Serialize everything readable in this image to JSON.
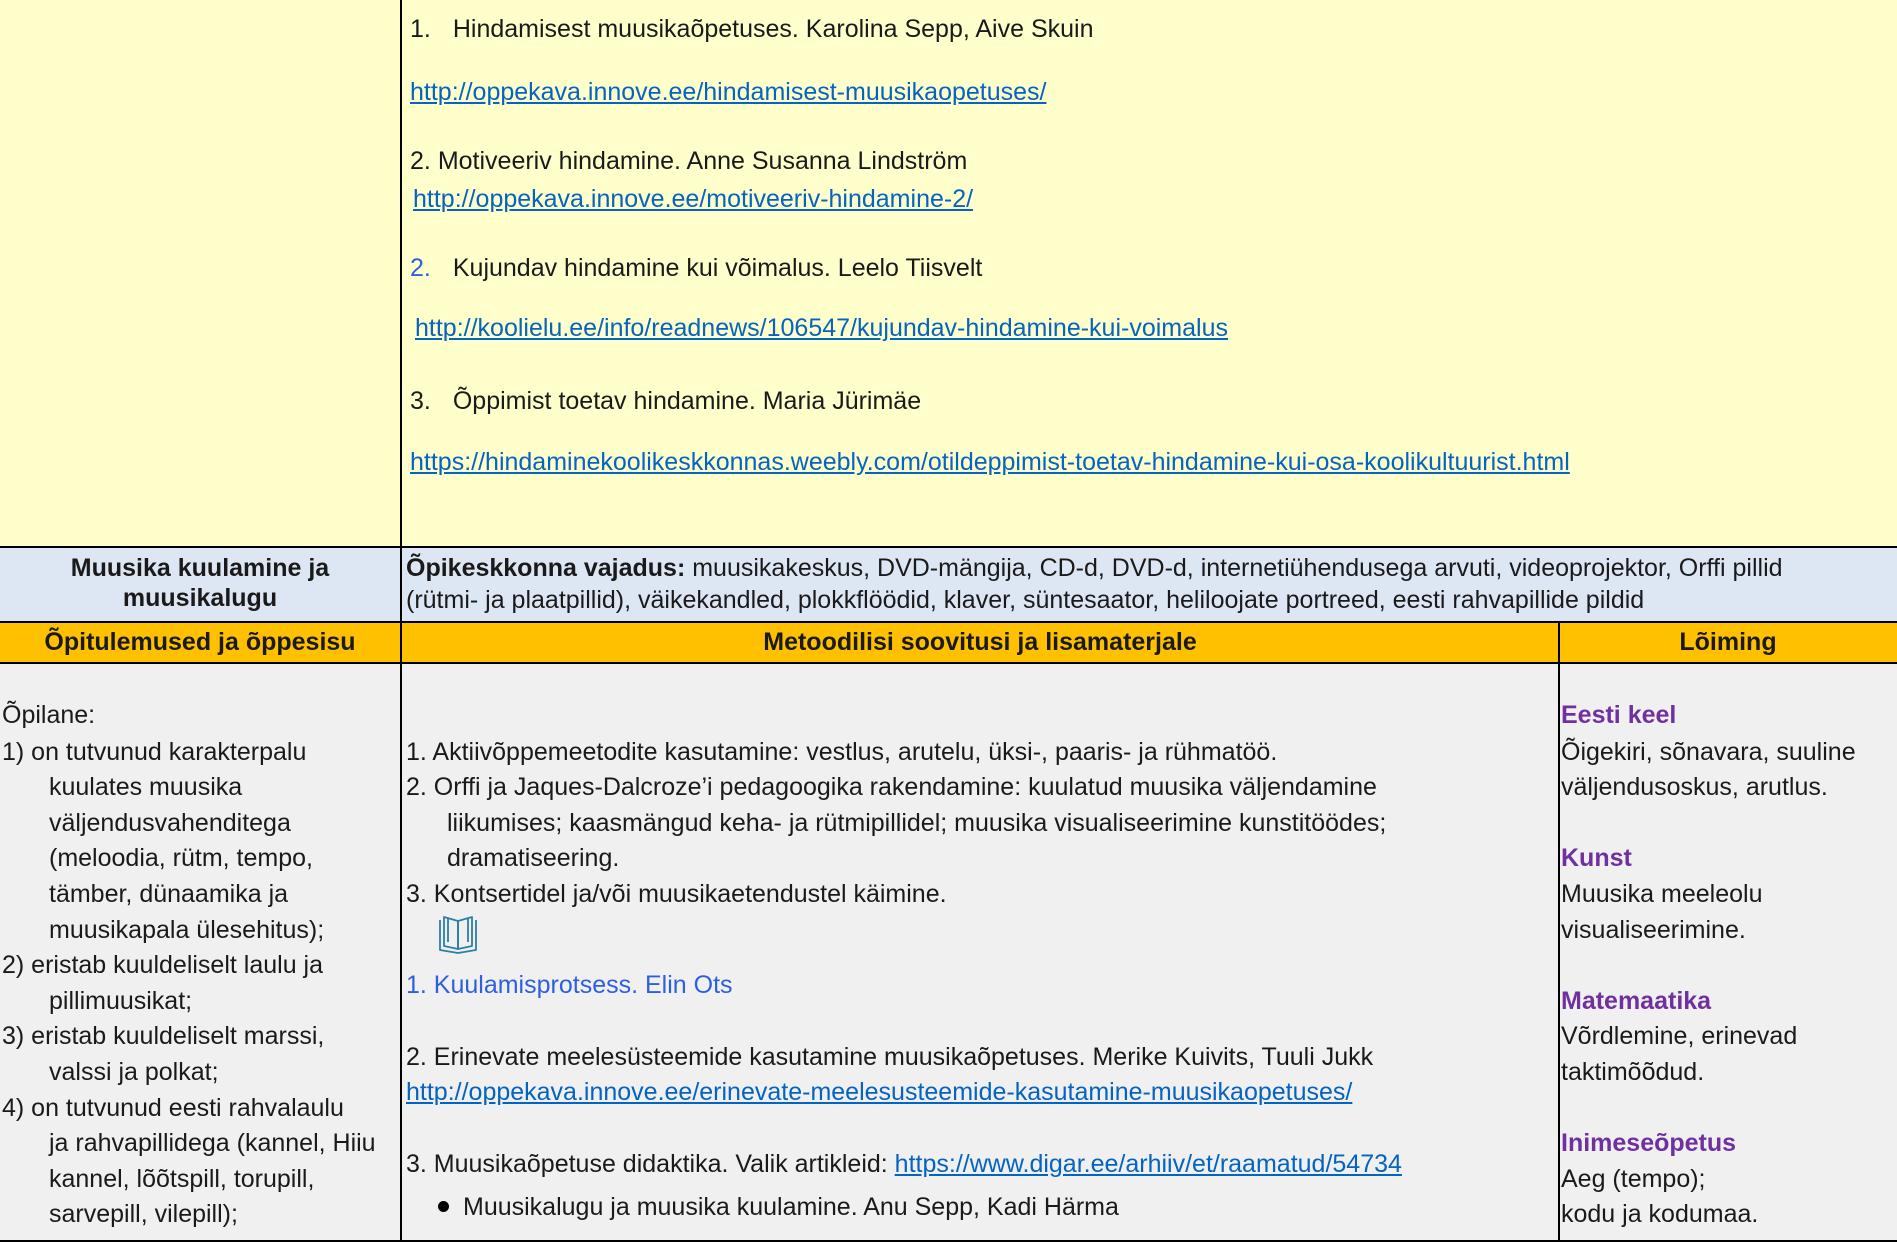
{
  "resources": [
    {
      "num": "1.",
      "text": "Hindamisest muusikaõpetuses. Karolina Sepp, Aive Skuin",
      "url": "http://oppekava.innove.ee/hindamisest-muusikaopetuses/"
    },
    {
      "num": "2.",
      "text": "Motiveeriv hindamine. Anne Susanna Lindström",
      "url": "http://oppekava.innove.ee/motiveeriv-hindamine-2/"
    },
    {
      "num": "2.",
      "text": "Kujundav hindamine kui võimalus. Leelo Tiisvelt",
      "url": "http://koolielu.ee/info/readnews/106547/kujundav-hindamine-kui-voimalus"
    },
    {
      "num": "3.",
      "text": "Õppimist toetav hindamine. Maria Jürimäe",
      "url": "https://hindaminekoolikeskkonnas.weebly.com/otildeppimist-toetav-hindamine-kui-osa-koolikultuurist.html"
    }
  ],
  "section": {
    "title_line1": "Muusika kuulamine ja",
    "title_line2": "muusikalugu",
    "env_label": "Õpikeskkonna  vajadus:",
    "env_text_line1": " muusikakeskus, DVD-mängija, CD-d, DVD-d, internetiühendusega arvuti, videoprojektor, Orffi pillid",
    "env_text_line2": "(rütmi- ja plaatpillid), väikekandled, plokkflöödid, klaver, süntesaator, heliloojate portreed, eesti rahvapillide pildid"
  },
  "headers": {
    "col1": "Õpitulemused ja õppesisu",
    "col2": "Metoodilisi soovitusi ja lisamaterjale",
    "col3": "Lõiming"
  },
  "outcomes": {
    "intro": "Õpilane:",
    "lines": [
      "1) on tutvunud karakterpalu",
      "kuulates muusika",
      "väljendusvahenditega",
      "(meloodia, rütm, tempo,",
      "tämber, dünaamika ja",
      "muusikapala ülesehitus);",
      "2) eristab kuuldeliselt laulu ja",
      "pillimuusikat;",
      "3) eristab kuuldeliselt marssi,",
      "valssi ja polkat;",
      "4) on tutvunud eesti rahvalaulu",
      "ja rahvapillidega (kannel, Hiiu",
      "kannel, lõõtspill, torupill,",
      "sarvepill, vilepill);"
    ]
  },
  "methods": {
    "lines": [
      "1. Aktiivõppemeetodite kasutamine: vestlus, arutelu, üksi-, paaris- ja rühmatöö.",
      "2. Orffi ja Jaques-Dalcroze’i pedagoogika rakendamine: kuulatud muusika väljendamine",
      "liikumises; kaasmängud keha- ja rütmipillidel; muusika visualiseerimine kunstitöödes;",
      "dramatiseering.",
      "3. Kontsertidel ja/või muusikaetendustel käimine."
    ],
    "book_icon": "open-book-icon",
    "ref1": "1. Kuulamisprotsess. Elin Ots",
    "ref2": "2. Erinevate meelesüsteemide kasutamine muusikaõpetuses. Merike Kuivits, Tuuli Jukk",
    "ref2_url": "http://oppekava.innove.ee/erinevate-meelesusteemide-kasutamine-muusikaopetuses/",
    "ref3_text": "3. Muusikaõpetuse didaktika. Valik artikleid: ",
    "ref3_url": "https://www.digar.ee/arhiiv/et/raamatud/54734",
    "bullet1": "Muusikalugu ja muusika kuulamine. Anu Sepp, Kadi Härma"
  },
  "integration": [
    {
      "subject": "Eesti keel",
      "lines": [
        "Õigekiri, sõnavara, suuline",
        "väljendusoskus, arutlus."
      ]
    },
    {
      "subject": "Kunst",
      "lines": [
        "Muusika meeleolu",
        "visualiseerimine."
      ]
    },
    {
      "subject": "Matemaatika",
      "lines": [
        "Võrdlemine, erinevad",
        "taktimõõdud."
      ]
    },
    {
      "subject": "Inimeseõpetus",
      "lines": [
        "Aeg (tempo);",
        "kodu ja kodumaa."
      ]
    }
  ],
  "colors": {
    "yellow_fill": "#ffffcc",
    "blue_fill": "#dde7f3",
    "header_orange": "#ffc000",
    "content_grey": "#f0f0f0",
    "link": "#0563c1",
    "subject_purple": "#7030a0"
  }
}
